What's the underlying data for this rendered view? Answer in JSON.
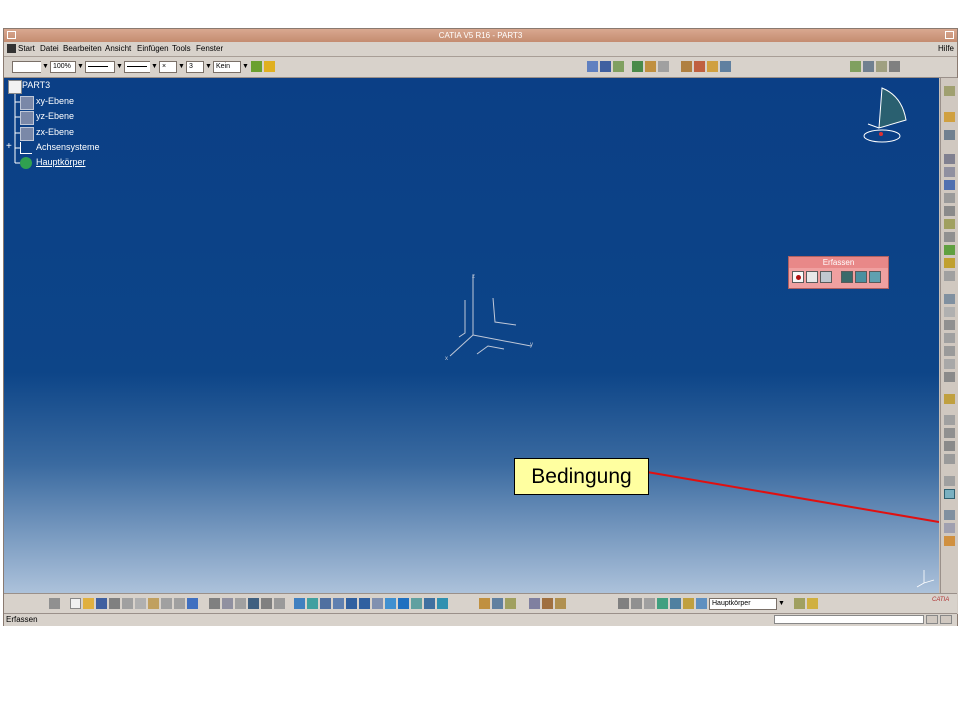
{
  "window": {
    "title": "CATIA V5 R16 - PART3"
  },
  "menu": {
    "start": "Start",
    "datei": "Datei",
    "bearbeiten": "Bearbeiten",
    "ansicht": "Ansicht",
    "einfuegen": "Einfügen",
    "tools": "Tools",
    "fenster": "Fenster",
    "hilfe": "Hilfe"
  },
  "toolbar_top": {
    "zoom": "100%",
    "point_style": "×",
    "line_weight": "3",
    "layer": "Kein"
  },
  "tree": {
    "root": "PART3",
    "items": [
      "xy-Ebene",
      "yz-Ebene",
      "zx-Ebene",
      "Achsensysteme",
      "Hauptkörper"
    ]
  },
  "erfassen": {
    "title": "Erfassen"
  },
  "callout": {
    "text": "Bedingung"
  },
  "bottom_toolbar": {
    "body_select": "Hauptkörper"
  },
  "status": {
    "text": "Erfassen"
  },
  "axis": {
    "x": "x",
    "y": "y",
    "z": "z"
  },
  "colors": {
    "callout_arrow": "#e01010",
    "viewport_top": "#0b3f86",
    "erfassen_bg": "#f0a0a0"
  }
}
